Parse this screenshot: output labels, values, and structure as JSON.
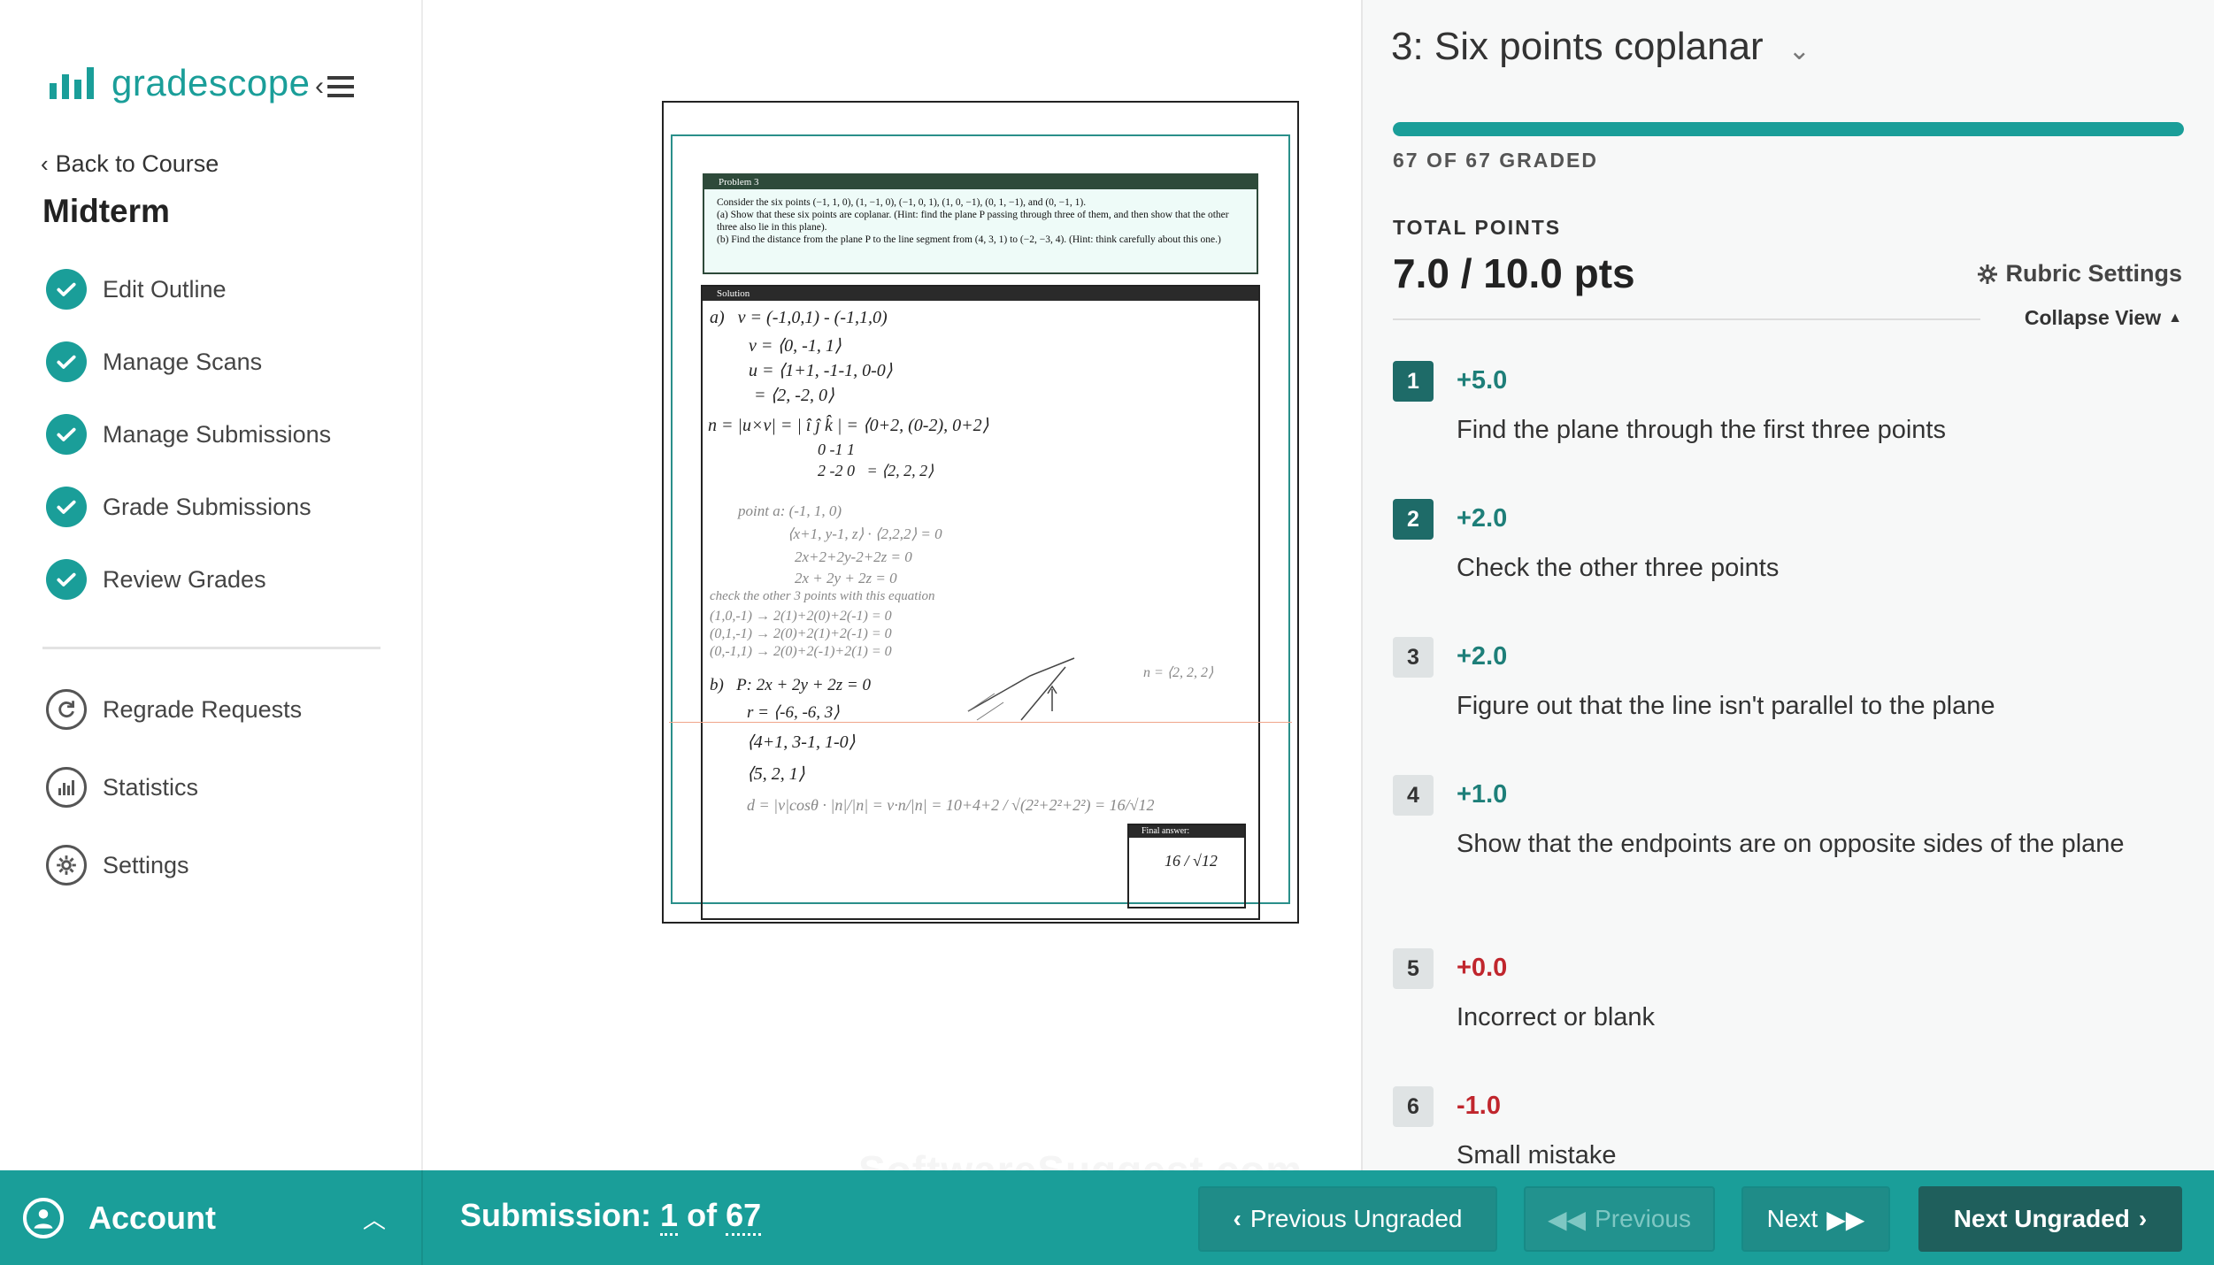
{
  "sidebar": {
    "logo_text": "gradescope",
    "back_label": "Back to Course",
    "course_title": "Midterm",
    "nav_items": [
      {
        "label": "Edit Outline"
      },
      {
        "label": "Manage Scans"
      },
      {
        "label": "Manage Submissions"
      },
      {
        "label": "Grade Submissions"
      },
      {
        "label": "Review Grades"
      }
    ],
    "nav_items2": [
      {
        "label": "Regrade Requests",
        "icon": "regrade-icon"
      },
      {
        "label": "Statistics",
        "icon": "statistics-icon"
      },
      {
        "label": "Settings",
        "icon": "settings-icon"
      }
    ]
  },
  "viewer": {
    "problem_header": "Problem 3",
    "problem_lines": [
      "Consider the six points (−1, 1, 0), (1, −1, 0), (−1, 0, 1), (1, 0, −1), (0, 1, −1), and (0, −1, 1).",
      "(a) Show that these six points are coplanar. (Hint: find the plane P passing through three of them, and then show that the other three also lie in this plane).",
      "(b) Find the distance from the plane P to the line segment from (4, 3, 1) to (−2, −3, 4). (Hint: think carefully about this one.)"
    ],
    "solution_header": "Solution",
    "final_answer_header": "Final answer:",
    "final_answer": "16 / √12",
    "watermark": "SoftwareSuggest.com"
  },
  "rubric": {
    "question_title": "3: Six points coplanar",
    "graded_count": "67 OF 67 GRADED",
    "progress_fraction": 1.0,
    "total_label": "TOTAL POINTS",
    "total_value": "7.0 / 10.0 pts",
    "settings_label": "Rubric Settings",
    "collapse_label": "Collapse View",
    "items": [
      {
        "key": "1",
        "points": "+5.0",
        "desc": "Find the plane through the first three points",
        "applied": true,
        "sign": "pos"
      },
      {
        "key": "2",
        "points": "+2.0",
        "desc": "Check the other three points",
        "applied": true,
        "sign": "pos"
      },
      {
        "key": "3",
        "points": "+2.0",
        "desc": "Figure out that the line isn't parallel to the plane",
        "applied": false,
        "sign": "pos"
      },
      {
        "key": "4",
        "points": "+1.0",
        "desc": "Show that the endpoints are on opposite sides of the plane",
        "applied": false,
        "sign": "pos"
      },
      {
        "key": "5",
        "points": "+0.0",
        "desc": "Incorrect or blank",
        "applied": false,
        "sign": "neg"
      },
      {
        "key": "6",
        "points": "-1.0",
        "desc": "Small mistake",
        "applied": false,
        "sign": "neg"
      }
    ]
  },
  "footer": {
    "account_label": "Account",
    "submission_label": "Submission:",
    "submission_current": "1",
    "submission_of": "of",
    "submission_total": "67",
    "btn_prev_ungraded": "Previous Ungraded",
    "btn_prev": "Previous",
    "btn_next": "Next",
    "btn_next_ungraded": "Next Ungraded"
  },
  "colors": {
    "brand": "#1a9e99",
    "applied_key": "#1e6b68",
    "negative": "#c0262d"
  }
}
